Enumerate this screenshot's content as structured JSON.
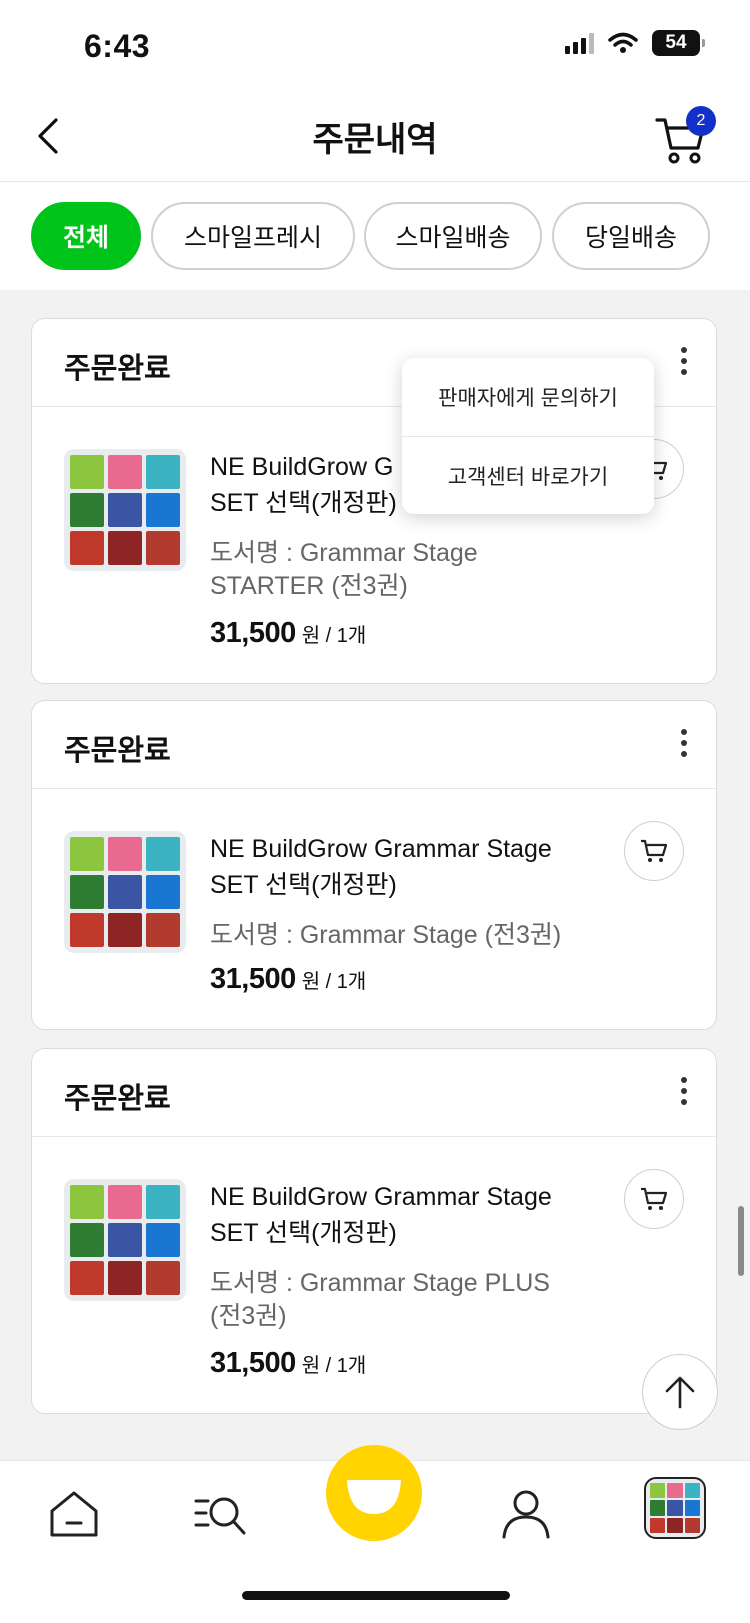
{
  "status_bar": {
    "time": "6:43",
    "battery": "54"
  },
  "header": {
    "title": "주문내역",
    "cart_count": "2"
  },
  "filters": [
    {
      "label": "전체",
      "active": true
    },
    {
      "label": "스마일프레시",
      "active": false
    },
    {
      "label": "스마일배송",
      "active": false
    },
    {
      "label": "당일배송",
      "active": false
    }
  ],
  "orders": [
    {
      "status": "주문완료",
      "title": "NE BuildGrow Grammar Stage SET 선택(개정판)",
      "title_visible": "NE BuildGrow G",
      "title_line2": "SET 선택(개정판)",
      "sub_line1": "도서명 : Grammar Stage",
      "sub_line2": "STARTER (전3권)",
      "price": "31,500",
      "unit": "원 / 1개"
    },
    {
      "status": "주문완료",
      "title_line1": "NE BuildGrow Grammar Stage",
      "title_line2": "SET 선택(개정판)",
      "sub_line1": "도서명 : Grammar Stage (전3권)",
      "price": "31,500",
      "unit": "원 / 1개"
    },
    {
      "status": "주문완료",
      "title_line1": "NE BuildGrow Grammar Stage",
      "title_line2": "SET 선택(개정판)",
      "sub_line1": "도서명 : Grammar Stage PLUS",
      "sub_line2": "(전3권)",
      "price": "31,500",
      "unit": "원 / 1개"
    }
  ],
  "popup_menu": [
    "판매자에게 문의하기",
    "고객센터 바로가기"
  ],
  "thumbnail_colors": [
    "#8cc63f",
    "#e86a8f",
    "#3bb3c3",
    "#2e7d32",
    "#3a55a4",
    "#1976d2",
    "#c0392b",
    "#8e2424",
    "#b23a2e"
  ],
  "colors": {
    "accent_green": "#00c41a",
    "badge_blue": "#1331c9",
    "smile_yellow": "#ffd400"
  },
  "icons": [
    "back-icon",
    "cart-icon",
    "more-vertical-icon",
    "add-to-cart-icon",
    "arrow-up-icon",
    "home-icon",
    "search-list-icon",
    "smile-icon",
    "user-icon"
  ]
}
